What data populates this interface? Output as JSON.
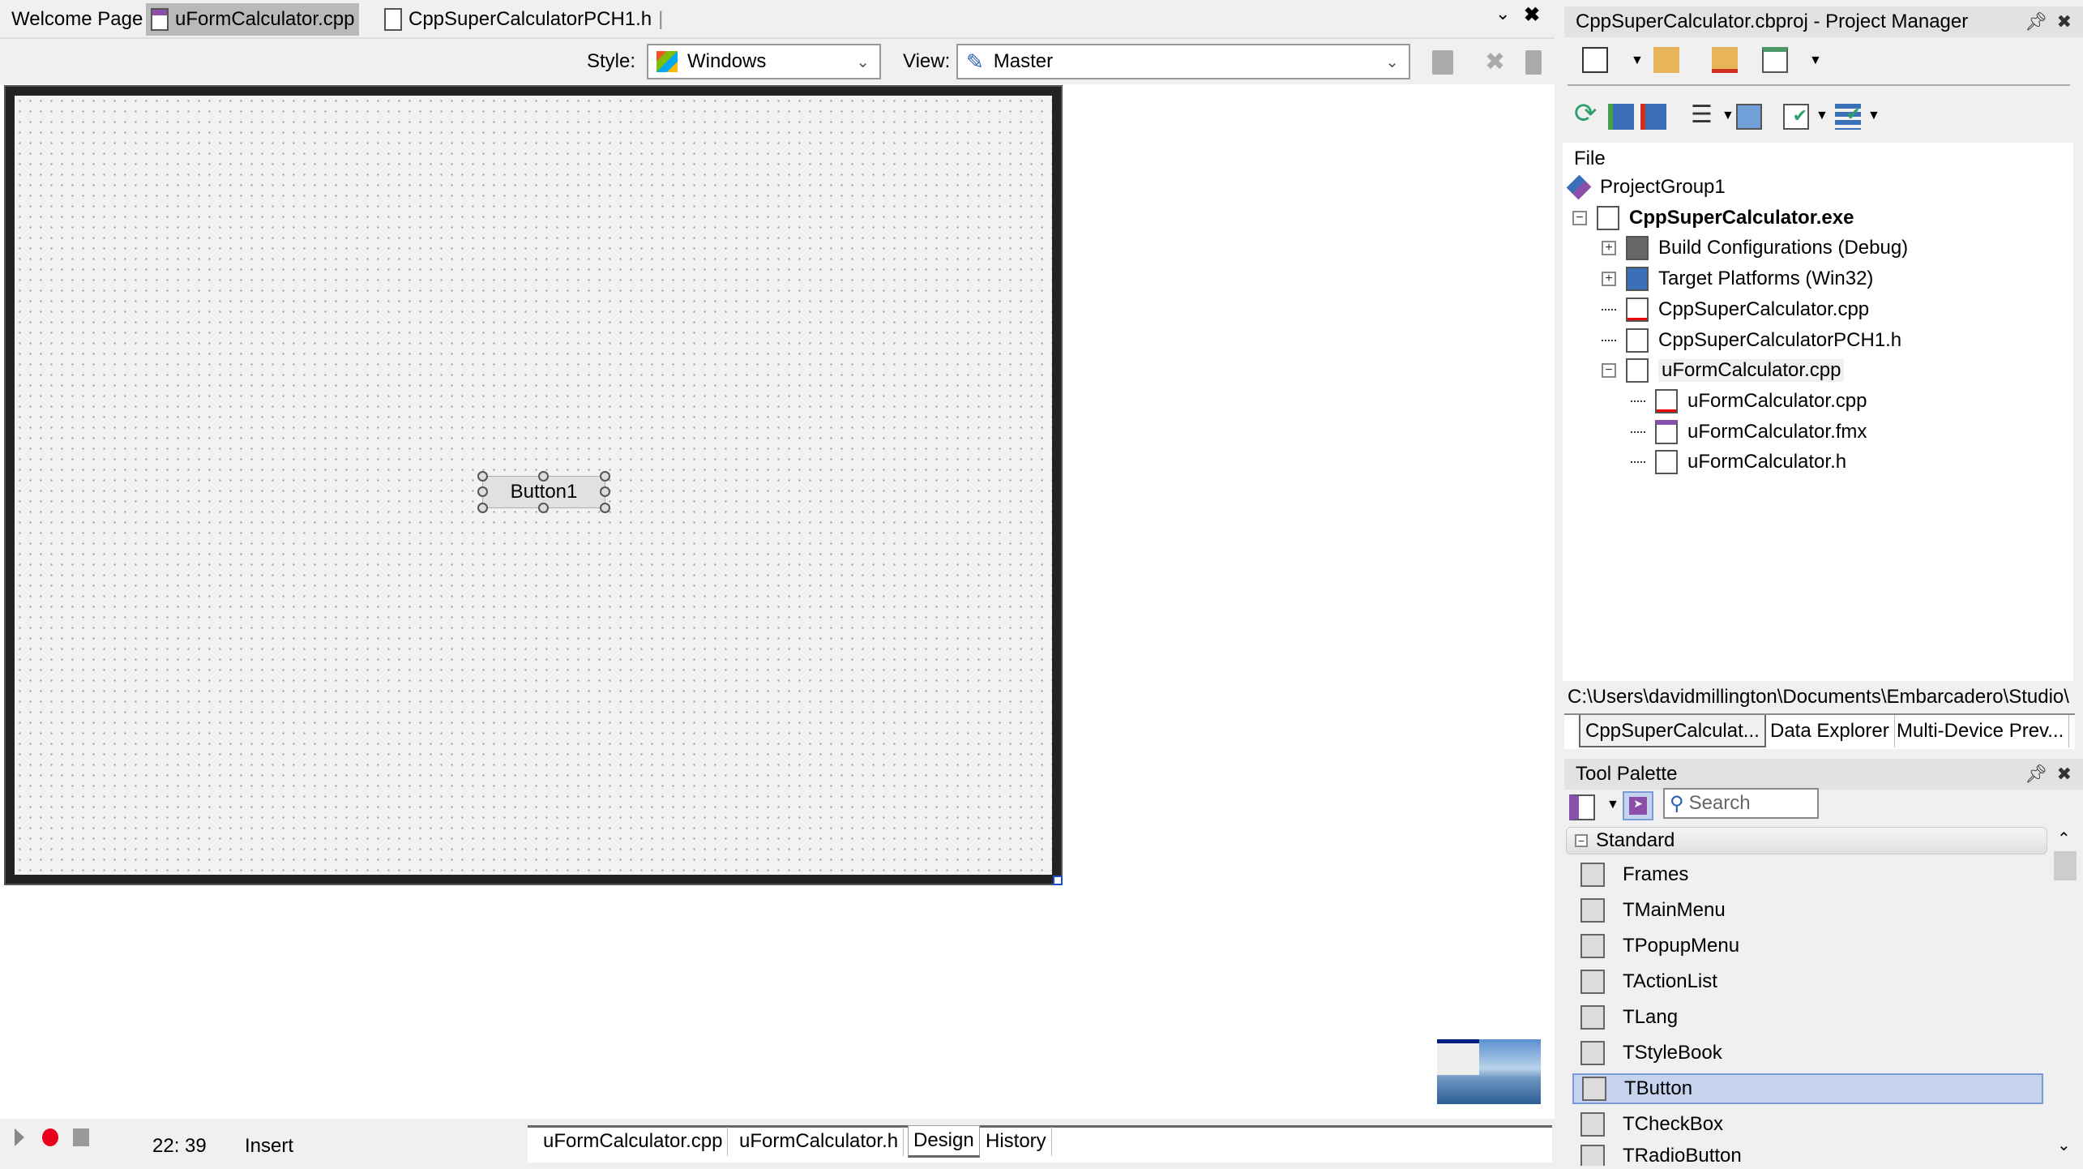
{
  "editor_tabs": [
    {
      "label": "Welcome Page",
      "selected": false
    },
    {
      "label": "uFormCalculator.cpp",
      "selected": true,
      "icon": "form-file-icon"
    },
    {
      "label": "CppSuperCalculatorPCH1.h",
      "selected": false,
      "icon": "header-file-icon"
    }
  ],
  "toolbar": {
    "style_label": "Style:",
    "style_value": "Windows",
    "view_label": "View:",
    "view_value": "Master"
  },
  "form": {
    "button_caption": "Button1"
  },
  "status_bar": {
    "position": "22: 39",
    "mode": "Insert"
  },
  "bottom_tabs": [
    {
      "label": "uFormCalculator.cpp",
      "selected": false
    },
    {
      "label": "uFormCalculator.h",
      "selected": false
    },
    {
      "label": "Design",
      "selected": true
    },
    {
      "label": "History",
      "selected": false
    }
  ],
  "project_manager": {
    "title": "CppSuperCalculator.cbproj - Project Manager",
    "column_header": "File",
    "tree": [
      {
        "label": "ProjectGroup1",
        "icon": "project-group-icon"
      },
      {
        "label": "CppSuperCalculator.exe",
        "icon": "exe-project-icon",
        "expander": "−",
        "bold": true
      },
      {
        "label": "Build Configurations (Debug)",
        "icon": "gear-icon",
        "expander": "+"
      },
      {
        "label": "Target Platforms (Win32)",
        "icon": "platforms-icon",
        "expander": "+"
      },
      {
        "label": "CppSuperCalculator.cpp",
        "icon": "cpp-file-icon"
      },
      {
        "label": "CppSuperCalculatorPCH1.h",
        "icon": "header-file-icon"
      },
      {
        "label": "uFormCalculator.cpp",
        "icon": "form-unit-icon",
        "expander": "−",
        "highlighted": true
      },
      {
        "label": "uFormCalculator.cpp",
        "icon": "cpp-file-icon"
      },
      {
        "label": "uFormCalculator.fmx",
        "icon": "fmx-file-icon"
      },
      {
        "label": "uFormCalculator.h",
        "icon": "header-file-icon"
      }
    ],
    "path": "C:\\Users\\davidmillington\\Documents\\Embarcadero\\Studio\\",
    "tabs": [
      "CppSuperCalculat...",
      "Data Explorer",
      "Multi-Device Prev..."
    ]
  },
  "tool_palette": {
    "title": "Tool Palette",
    "search_placeholder": "Search",
    "category": "Standard",
    "items": [
      {
        "label": "Frames"
      },
      {
        "label": "TMainMenu"
      },
      {
        "label": "TPopupMenu"
      },
      {
        "label": "TActionList"
      },
      {
        "label": "TLang"
      },
      {
        "label": "TStyleBook"
      },
      {
        "label": "TButton",
        "selected": true
      },
      {
        "label": "TCheckBox"
      },
      {
        "label": "TRadioButton"
      }
    ]
  },
  "colors": {
    "selection": "#c5d3ee",
    "selection_border": "#7a9ad8",
    "accent_purple": "#8a4fa8",
    "record_red": "#e8001c"
  }
}
